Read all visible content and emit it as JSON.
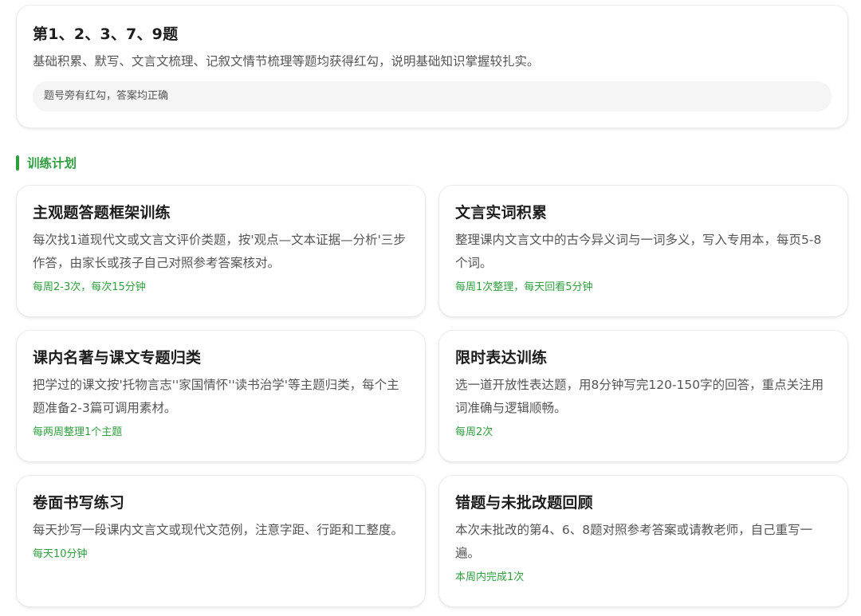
{
  "colors": {
    "accent": "#2f9e3f",
    "text": "#1d1d1d",
    "muted": "#555555",
    "pill_bg": "#f5f5f5"
  },
  "summary": {
    "title": "第1、2、3、7、9题",
    "description": "基础积累、默写、文言文梳理、记叙文情节梳理等题均获得红勾，说明基础知识掌握较扎实。",
    "note": "题号旁有红勾，答案均正确"
  },
  "plan": {
    "heading": "训练计划",
    "items": [
      {
        "title": "主观题答题框架训练",
        "description": "每次找1道现代文或文言文评价类题，按'观点—文本证据—分析'三步作答，由家长或孩子自己对照参考答案核对。",
        "frequency": "每周2-3次，每次15分钟"
      },
      {
        "title": "文言实词积累",
        "description": "整理课内文言文中的古今异义词与一词多义，写入专用本，每页5-8个词。",
        "frequency": "每周1次整理，每天回看5分钟"
      },
      {
        "title": "课内名著与课文专题归类",
        "description": "把学过的课文按'托物言志''家国情怀''读书治学'等主题归类，每个主题准备2-3篇可调用素材。",
        "frequency": "每两周整理1个主题"
      },
      {
        "title": "限时表达训练",
        "description": "选一道开放性表达题，用8分钟写完120-150字的回答，重点关注用词准确与逻辑顺畅。",
        "frequency": "每周2次"
      },
      {
        "title": "卷面书写练习",
        "description": "每天抄写一段课内文言文或现代文范例，注意字距、行距和工整度。",
        "frequency": "每天10分钟"
      },
      {
        "title": "错题与未批改题回顾",
        "description": "本次未批改的第4、6、8题对照参考答案或请教老师，自己重写一遍。",
        "frequency": "本周内完成1次"
      }
    ]
  }
}
